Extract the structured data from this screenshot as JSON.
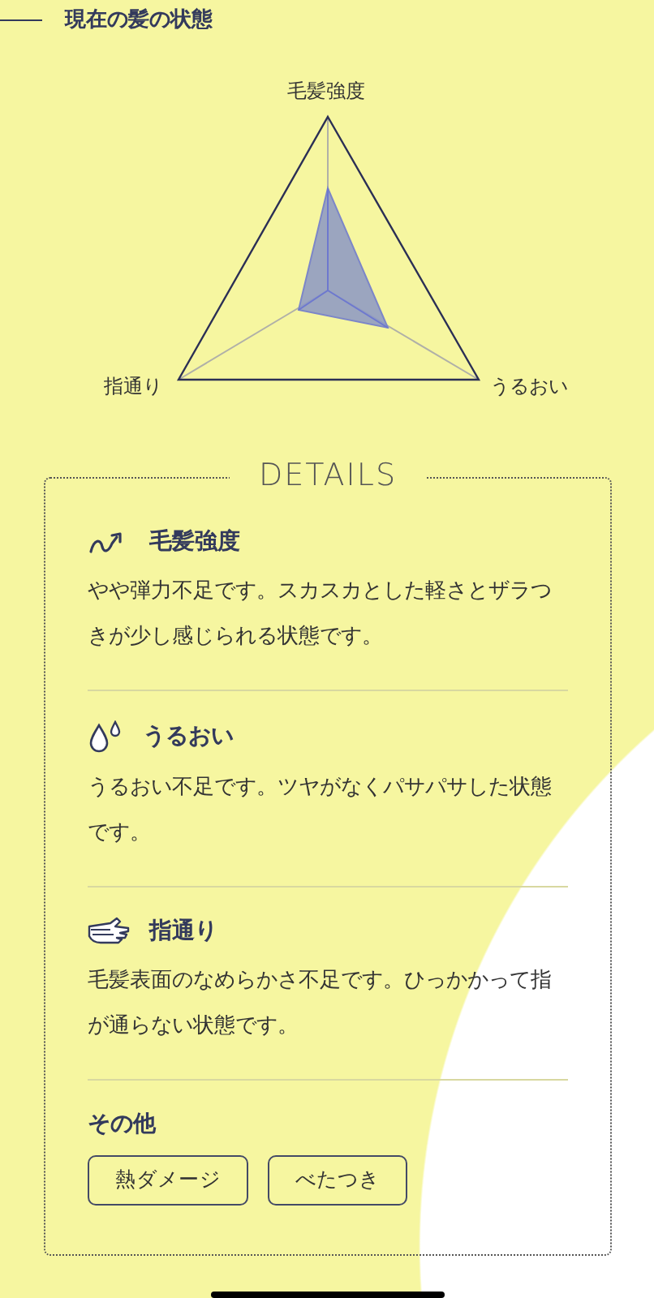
{
  "header": {
    "title": "現在の髪の状態"
  },
  "radar": {
    "axes": [
      "毛髪強度",
      "うるおい",
      "指通り"
    ]
  },
  "details": {
    "title": "DETAILS",
    "items": [
      {
        "kind": "strength",
        "title": "毛髪強度",
        "text": "やや弾力不足です。スカスカとした軽さとザラつきが少し感じられる状態です。"
      },
      {
        "kind": "moisture",
        "title": "うるおい",
        "text": "うるおい不足です。ツヤがなくパサパサした状態です。"
      },
      {
        "kind": "smoothness",
        "title": "指通り",
        "text": "毛髪表面のなめらかさ不足です。ひっかかって指が通らない状態です。"
      }
    ],
    "other": {
      "title": "その他",
      "tags": [
        "熱ダメージ",
        "べたつき"
      ]
    }
  }
}
